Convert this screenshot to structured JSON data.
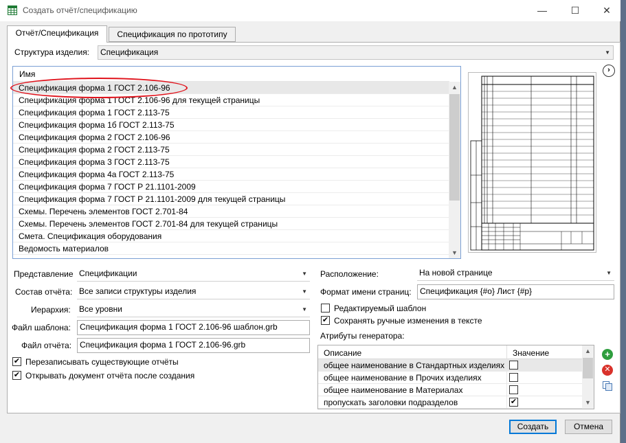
{
  "window": {
    "title": "Создать отчёт/спецификацию",
    "minimize_glyph": "—",
    "maximize_glyph": "☐",
    "close_glyph": "✕"
  },
  "tabs": [
    {
      "label": "Отчёт/Спецификация",
      "active": true
    },
    {
      "label": "Спецификация по прототипу",
      "active": false
    }
  ],
  "structure": {
    "label": "Структура изделия:",
    "value": "Спецификация"
  },
  "template_list": {
    "header": "Имя",
    "items": [
      "Спецификация форма 1 ГОСТ 2.106-96",
      "Спецификация форма 1 ГОСТ 2.106-96 для текущей страницы",
      "Спецификация форма 1 ГОСТ 2.113-75",
      "Спецификация форма 1б ГОСТ 2.113-75",
      "Спецификация форма 2 ГОСТ 2.106-96",
      "Спецификация форма 2 ГОСТ 2.113-75",
      "Спецификация форма 3 ГОСТ 2.113-75",
      "Спецификация форма 4а ГОСТ 2.113-75",
      "Спецификация форма 7 ГОСТ  Р 21.1101-2009",
      "Спецификация форма 7 ГОСТ  Р 21.1101-2009 для текущей страницы",
      "Схемы. Перечень элементов ГОСТ 2.701-84",
      "Схемы. Перечень элементов ГОСТ 2.701-84 для текущей страницы",
      "Смета. Спецификация оборудования",
      "Ведомость материалов"
    ],
    "selected_index": 0
  },
  "left_form": {
    "representation_label": "Представление",
    "representation_value": "Спецификации",
    "composition_label": "Состав отчёта:",
    "composition_value": "Все записи структуры изделия",
    "hierarchy_label": "Иерархия:",
    "hierarchy_value": "Все уровни",
    "template_file_label": "Файл шаблона:",
    "template_file_value": "Спецификация форма 1 ГОСТ 2.106-96 шаблон.grb",
    "report_file_label": "Файл отчёта:",
    "report_file_value": "Спецификация форма 1 ГОСТ 2.106-96.grb",
    "overwrite_label": "Перезаписывать существующие отчёты",
    "overwrite_checked": true,
    "open_after_label": "Открывать документ отчёта после создания",
    "open_after_checked": true
  },
  "right_form": {
    "placement_label": "Расположение:",
    "placement_value": "На новой странице",
    "page_name_format_label": "Формат имени страниц:",
    "page_name_format_value": "Спецификация {#o} Лист {#p}",
    "editable_template_label": "Редактируемый шаблон",
    "editable_template_checked": false,
    "keep_manual_label": "Сохранять ручные изменения в тексте",
    "keep_manual_checked": true,
    "generator_attributes_label": "Атрибуты генератора:"
  },
  "attributes": {
    "col_description": "Описание",
    "col_value": "Значение",
    "rows": [
      {
        "description": "общее наименование в Стандартных изделиях",
        "checked": false
      },
      {
        "description": "общее наименование в Прочих изделиях",
        "checked": false
      },
      {
        "description": "общее наименование в Материалах",
        "checked": false
      },
      {
        "description": "пропускать заголовки подразделов",
        "checked": true
      }
    ]
  },
  "buttons": {
    "create": "Создать",
    "cancel": "Отмена"
  },
  "icons": {
    "app": "spreadsheet-icon",
    "add": "add-icon",
    "delete": "delete-icon",
    "copy": "copy-icon",
    "next": "chevron-right-icon",
    "dropdown": "chevron-down-icon",
    "check": "✔"
  },
  "colors": {
    "highlight_ellipse": "#e0131c",
    "list_border": "#7a9fd4",
    "add_green": "#2e9e3e",
    "delete_red": "#d9322b"
  }
}
